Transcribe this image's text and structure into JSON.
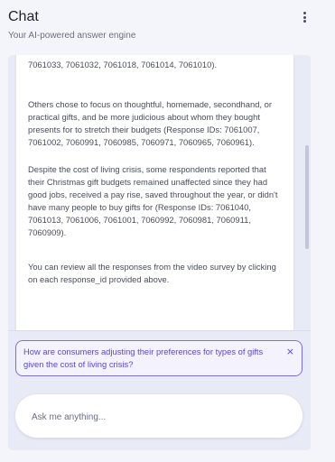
{
  "header": {
    "title": "Chat",
    "subtitle": "Your AI-powered answer engine",
    "menu_icon": "more-vertical-icon"
  },
  "message": {
    "paragraphs": [
      "7061033, 7061032, 7061018, 7061014, 7061010).",
      "Others chose to focus on thoughtful, homemade, secondhand, or practical gifts, and be more judicious about whom they bought presents for to stretch their budgets (Response IDs: 7061007, 7061002, 7060991, 7060985, 7060971, 7060965, 7060961).",
      "Despite the cost of living crisis, some respondents reported that their Christmas gift budgets remained unaffected since they had good jobs, received a pay rise, saved throughout the year, or didn't have many people to buy gifts for (Response IDs: 7061040, 7061013, 7061006, 7061001, 7060992, 7060981, 7060911, 7060909).",
      "You can review all the responses from the video survey by clicking on each response_id provided above."
    ],
    "feedback_icons": [
      "thumbs-down-icon",
      "thumbs-up-icon"
    ]
  },
  "suggestion": {
    "text": "How are consumers adjusting their preferences for types of gifts given the cost of living crisis?",
    "close_glyph": "×"
  },
  "input": {
    "placeholder": "Ask me anything..."
  },
  "colors": {
    "background": "#f4f5fb",
    "panel": "#e8eaf6",
    "accent": "#5b4bc4",
    "accent_border": "#7e6fd6",
    "text": "#4a4d5a"
  }
}
